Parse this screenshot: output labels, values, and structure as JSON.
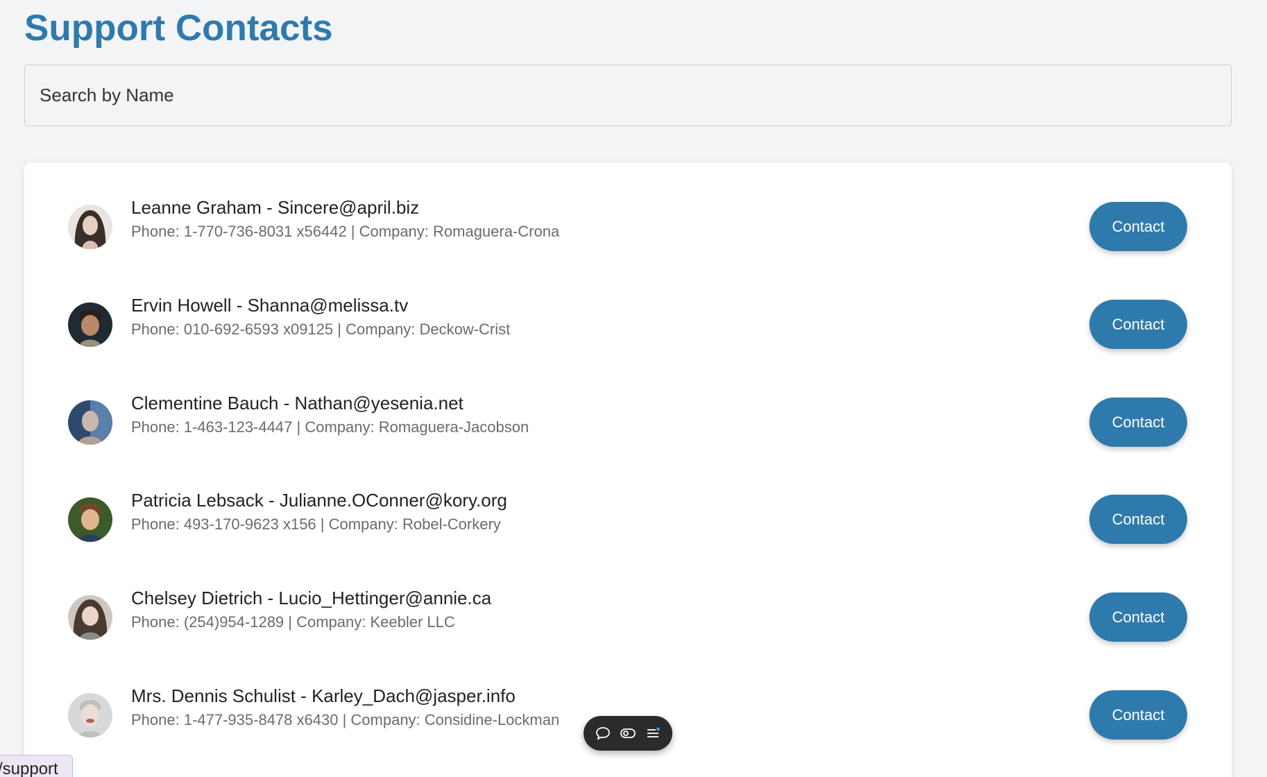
{
  "header": {
    "title": "Support Contacts"
  },
  "search": {
    "placeholder": "Search by Name",
    "value": ""
  },
  "contacts": [
    {
      "name_line": "Leanne Graham - Sincere@april.biz",
      "details_line": "Phone: 1-770-736-8031 x56442 | Company: Romaguera-Crona",
      "button_label": "Contact",
      "avatar_colors": [
        "#3a2e2a",
        "#e6cfc2"
      ]
    },
    {
      "name_line": "Ervin Howell - Shanna@melissa.tv",
      "details_line": "Phone: 010-692-6593 x09125 | Company: Deckow-Crist",
      "button_label": "Contact",
      "avatar_colors": [
        "#1f2a33",
        "#b88a6a"
      ]
    },
    {
      "name_line": "Clementine Bauch - Nathan@yesenia.net",
      "details_line": "Phone: 1-463-123-4447 | Company: Romaguera-Jacobson",
      "button_label": "Contact",
      "avatar_colors": [
        "#2d4a6e",
        "#c9b8ad"
      ]
    },
    {
      "name_line": "Patricia Lebsack - Julianne.OConner@kory.org",
      "details_line": "Phone: 493-170-9623 x156 | Company: Robel-Corkery",
      "button_label": "Contact",
      "avatar_colors": [
        "#3d5a2a",
        "#e2b592"
      ]
    },
    {
      "name_line": "Chelsey Dietrich - Lucio_Hettinger@annie.ca",
      "details_line": "Phone: (254)954-1289 | Company: Keebler LLC",
      "button_label": "Contact",
      "avatar_colors": [
        "#4a3a30",
        "#ead5c8"
      ]
    },
    {
      "name_line": "Mrs. Dennis Schulist - Karley_Dach@jasper.info",
      "details_line": "Phone: 1-477-935-8478 x6430 | Company: Considine-Lockman",
      "button_label": "Contact",
      "avatar_colors": [
        "#d8d8d8",
        "#e9ddd6"
      ]
    }
  ],
  "route_tag": {
    "label": "/support"
  },
  "colors": {
    "accent": "#2f7aad",
    "background": "#f3f4f6",
    "card": "#ffffff"
  },
  "floating_toolbar": {
    "icons": [
      "chat-bubble-icon",
      "toggle-icon",
      "list-icon"
    ]
  }
}
